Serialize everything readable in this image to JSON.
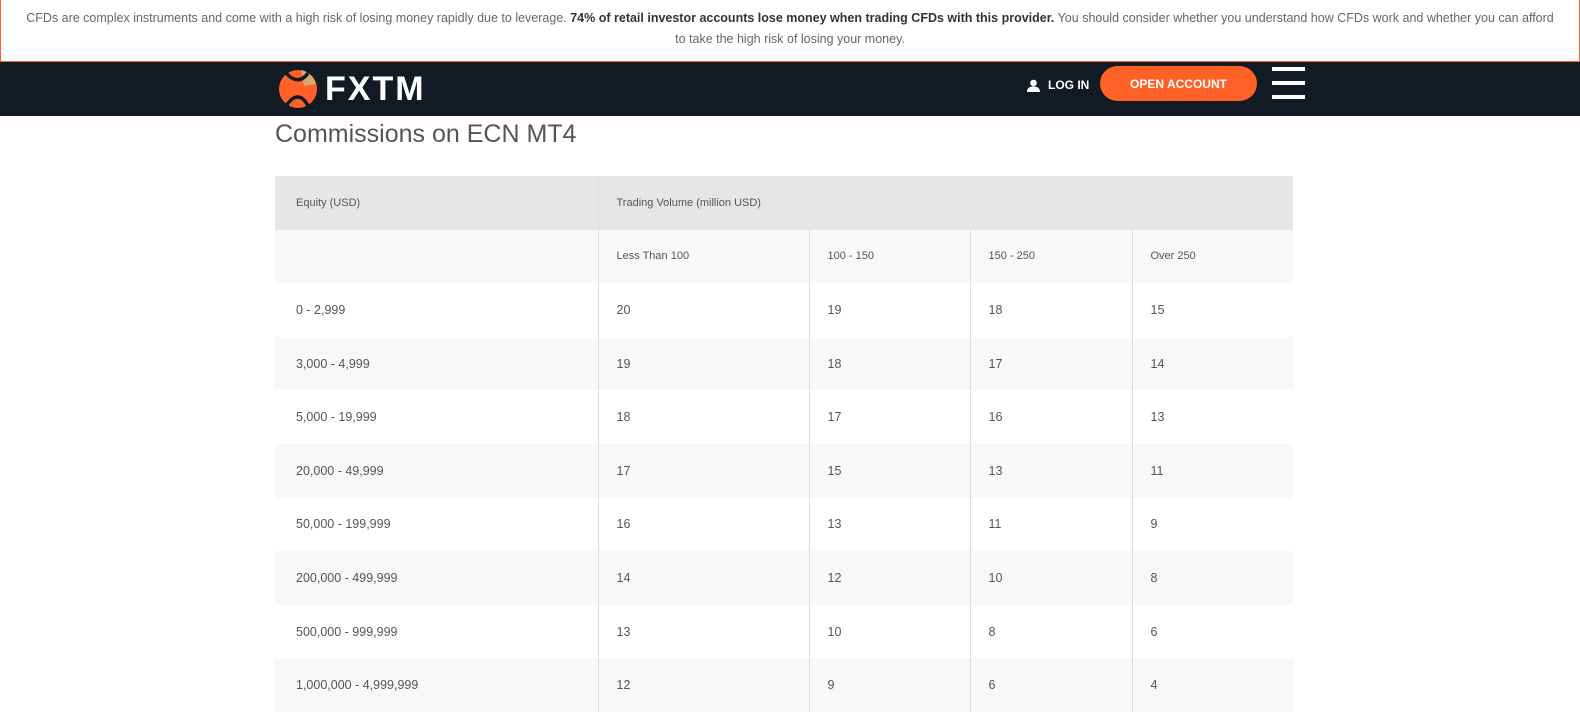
{
  "banner": {
    "text1": "CFDs are complex instruments and come with a high risk of losing money rapidly due to leverage. ",
    "bold": "74% of retail investor accounts lose money when trading CFDs with this provider.",
    "text2": " You should consider whether you understand how CFDs work and whether you can afford to take the high risk of losing your money."
  },
  "header": {
    "logo": "FXTM",
    "login": "LOG IN",
    "open_account": "OPEN ACCOUNT"
  },
  "title": "Commissions on ECN MT4",
  "table": {
    "equity_header": "Equity (USD)",
    "volume_header": "Trading Volume (million USD)",
    "columns": [
      "Less Than 100",
      "100 - 150",
      "150 - 250",
      "Over 250"
    ],
    "rows": [
      {
        "equity": "0 - 2,999",
        "values": [
          "20",
          "19",
          "18",
          "15"
        ]
      },
      {
        "equity": "3,000 - 4,999",
        "values": [
          "19",
          "18",
          "17",
          "14"
        ]
      },
      {
        "equity": "5,000 - 19,999",
        "values": [
          "18",
          "17",
          "16",
          "13"
        ]
      },
      {
        "equity": "20,000 - 49,999",
        "values": [
          "17",
          "15",
          "13",
          "11"
        ]
      },
      {
        "equity": "50,000 - 199,999",
        "values": [
          "16",
          "13",
          "11",
          "9"
        ]
      },
      {
        "equity": "200,000 - 499,999",
        "values": [
          "14",
          "12",
          "10",
          "8"
        ]
      },
      {
        "equity": "500,000 - 999,999",
        "values": [
          "13",
          "10",
          "8",
          "6"
        ]
      },
      {
        "equity": "1,000,000 - 4,999,999",
        "values": [
          "12",
          "9",
          "6",
          "4"
        ]
      }
    ]
  }
}
